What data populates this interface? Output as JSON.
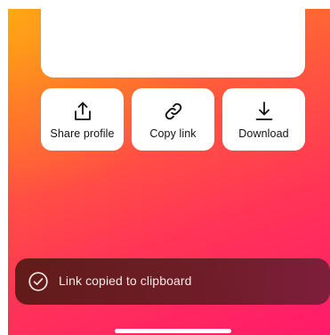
{
  "share_actions": [
    {
      "label": "Share profile",
      "icon": "share-icon"
    },
    {
      "label": "Copy link",
      "icon": "link-icon"
    },
    {
      "label": "Download",
      "icon": "download-icon"
    }
  ],
  "toast": {
    "message": "Link copied to clipboard",
    "icon": "check-circle-icon"
  },
  "colors": {
    "gradient_start": "#ff8a1e",
    "gradient_mid": "#ff3556",
    "gradient_end": "#ff1a6a",
    "card": "#ffffff",
    "toast_bg": "#5a1c1c",
    "toast_text": "#f3e8e6",
    "label_text": "#111111"
  }
}
